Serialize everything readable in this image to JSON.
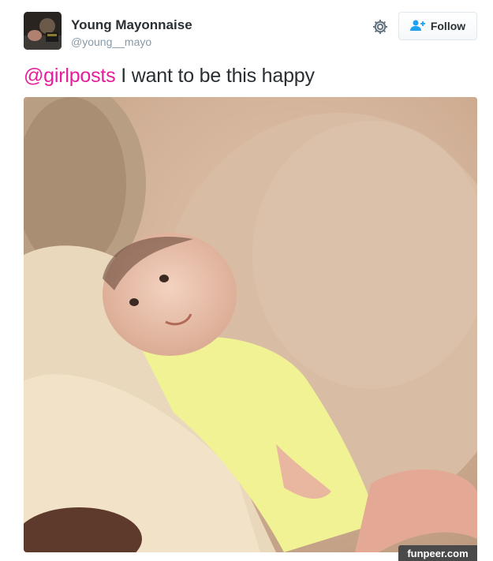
{
  "tweet": {
    "author_name": "Young Mayonnaise",
    "author_handle": "@young__mayo",
    "mention": "@girlposts",
    "text": " I want to be this happy"
  },
  "actions": {
    "settings_icon": "gear-icon",
    "follow_icon": "add-person-icon",
    "follow_label": "Follow"
  },
  "watermark": "funpeer.com",
  "colors": {
    "mention": "#e81c9a",
    "follow_icon": "#1da1f2",
    "handle": "#8899a6"
  }
}
